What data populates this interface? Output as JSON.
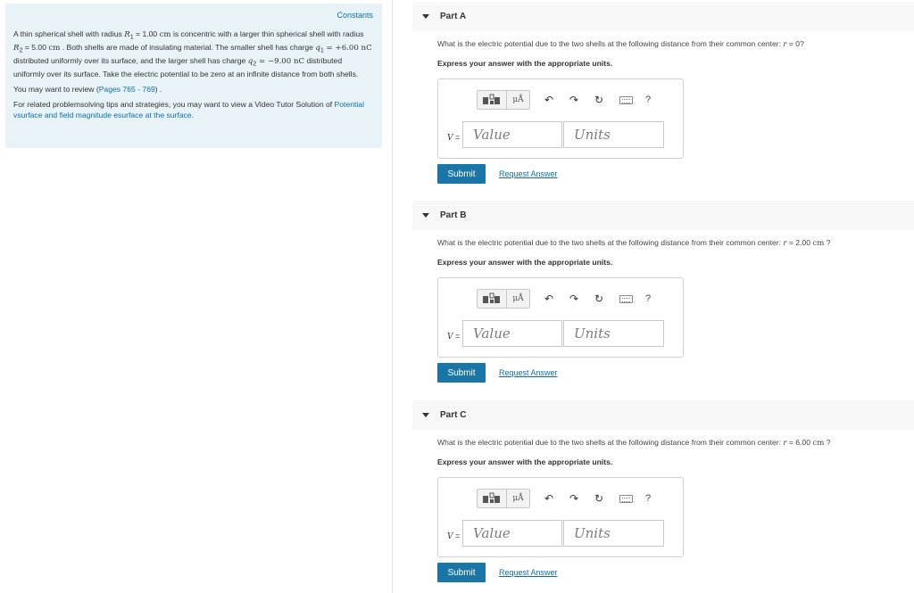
{
  "left": {
    "constants_label": "Constants",
    "problem": {
      "t1": "A thin spherical shell with radius ",
      "r1_sym": "R",
      "r1_sub": "1",
      "t2": " = 1.00 ",
      "r1_unit": "cm",
      "t3": " is concentric with a larger thin spherical shell with radius ",
      "r2_sym": "R",
      "r2_sub": "2",
      "t4": " = 5.00 ",
      "r2_unit": "cm",
      "t5": " . Both shells are made of insulating material. The smaller shell has charge ",
      "q1_sym": "q",
      "q1_sub": "1",
      "q1_val": " = +6.00 nC",
      "t6": " distributed uniformly over its surface, and the larger shell has charge ",
      "q2_sym": "q",
      "q2_sub": "2",
      "q2_val": " = −9.00 nC",
      "t7": " distributed uniformly over its surface. Take the electric potential to be zero at an infinite distance from both shells."
    },
    "review_prefix": "You may want to review (",
    "review_link": "Pages 765 - 769",
    "review_suffix": ") .",
    "tips_prefix": "For related problemsolving tips and strategies, you may want to view a Video Tutor Solution of ",
    "tips_link": "Potential vsurface and field magnitude esurface at the surface",
    "tips_suffix": "."
  },
  "parts": [
    {
      "title": "Part A",
      "question_prefix": "What is the electric potential due to the two shells at the following distance from their common center: ",
      "r_sym": "r",
      "r_val": " = 0",
      "r_unit": "",
      "question_suffix": "?",
      "express": "Express your answer with the appropriate units.",
      "var_label": "V",
      "equals": " =",
      "value_placeholder": "Value",
      "units_placeholder": "Units",
      "submit": "Submit",
      "request": "Request Answer"
    },
    {
      "title": "Part B",
      "question_prefix": "What is the electric potential due to the two shells at the following distance from their common center: ",
      "r_sym": "r",
      "r_val": " = 2.00 ",
      "r_unit": "cm",
      "question_suffix": " ?",
      "express": "Express your answer with the appropriate units.",
      "var_label": "V",
      "equals": " =",
      "value_placeholder": "Value",
      "units_placeholder": "Units",
      "submit": "Submit",
      "request": "Request Answer"
    },
    {
      "title": "Part C",
      "question_prefix": "What is the electric potential due to the two shells at the following distance from their common center: ",
      "r_sym": "r",
      "r_val": " = 6.00 ",
      "r_unit": "cm",
      "question_suffix": " ?",
      "express": "Express your answer with the appropriate units.",
      "var_label": "V",
      "equals": " =",
      "value_placeholder": "Value",
      "units_placeholder": "Units",
      "submit": "Submit",
      "request": "Request Answer"
    }
  ],
  "toolbar": {
    "units_button_label": "μÅ",
    "undo_glyph": "↶",
    "redo_glyph": "↷",
    "reset_glyph": "↻",
    "help_glyph": "?",
    "icons": [
      "templates-icon",
      "units-icon",
      "undo-icon",
      "redo-icon",
      "reset-icon",
      "keyboard-icon",
      "help-icon"
    ]
  },
  "colors": {
    "info_bg": "#e8f3f7",
    "link": "#0f6fa6",
    "submit_bg": "#1b76a8",
    "header_bg": "#f8f8f8"
  }
}
